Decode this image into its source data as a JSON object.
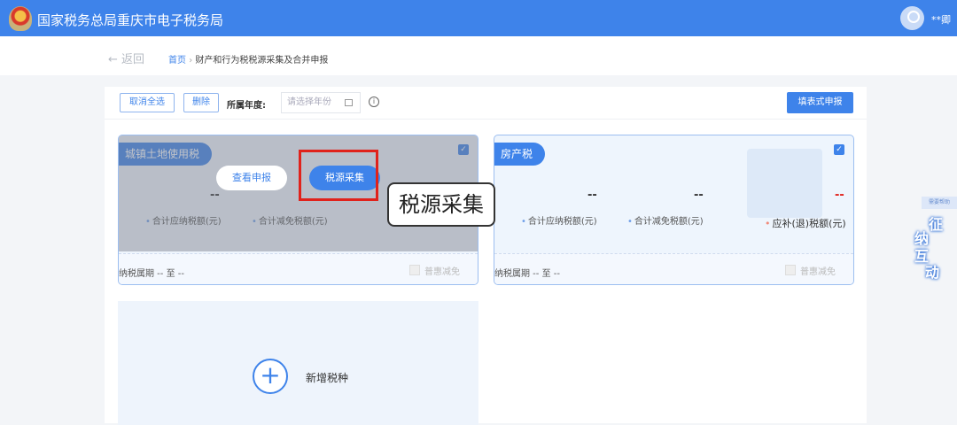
{
  "header": {
    "title": "国家税务总局重庆市电子税务局",
    "user": "**卿"
  },
  "nav": {
    "back": "← 返回",
    "home": "首页",
    "separator": "›",
    "current": "财产和行为税税源采集及合并申报"
  },
  "toolbar": {
    "deselect_all": "取消全选",
    "delete": "删除",
    "year_label": "所属年度:",
    "year_placeholder": "请选择年份",
    "calendar_icon": "📅",
    "info_icon": "i",
    "fill_form": "填表式申报"
  },
  "cards": [
    {
      "tag": "城镇土地使用税",
      "checked": true,
      "values": [
        "--"
      ],
      "captions": [
        "合计应纳税额(元)",
        "合计减免税额(元)"
      ],
      "view_btn": "查看申报",
      "collect_btn": "税源采集",
      "period": "纳税属期 -- 至 --",
      "discount": "普惠减免"
    },
    {
      "tag": "房产税",
      "checked": true,
      "values": [
        "--",
        "--",
        "--"
      ],
      "captions": [
        "合计应纳税额(元)",
        "合计减免税额(元)",
        "应补(退)税额(元)"
      ],
      "period": "纳税属期 -- 至 --",
      "discount": "普惠减免"
    }
  ],
  "tooltip": "税源采集",
  "add": {
    "icon": "+",
    "label": "新增税种"
  },
  "side_widget": {
    "small": "需要帮助",
    "chars": [
      "征",
      "纳",
      "互",
      "动"
    ]
  },
  "colors": {
    "brand": "#3e83ea",
    "highlight": "#e0221b",
    "refund": "#e0221b"
  }
}
